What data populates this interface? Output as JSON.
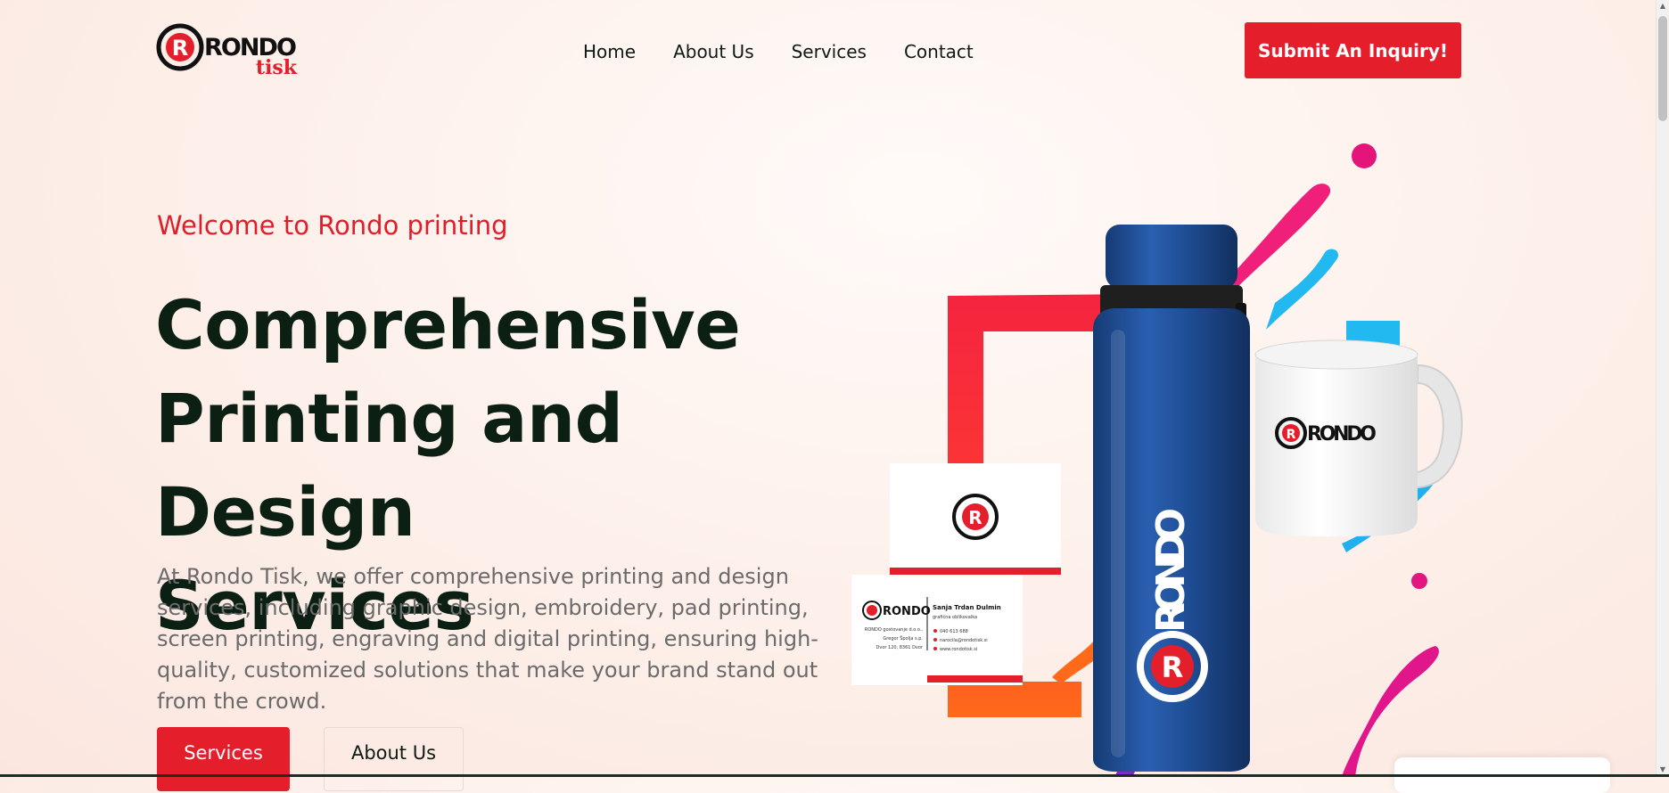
{
  "brand": {
    "logo_main": "RONDO",
    "logo_sub": "tisk",
    "logo_letter": "R"
  },
  "nav": {
    "items": [
      "Home",
      "About Us",
      "Services",
      "Contact"
    ]
  },
  "header": {
    "cta_label": "Submit An Inquiry!"
  },
  "hero": {
    "welcome": "Welcome to Rondo printing",
    "headline_line1": "Comprehensive",
    "headline_line2": "Printing and Design",
    "headline_line3": "Services",
    "description": "At Rondo Tisk, we offer comprehensive printing and design services, including graphic design, embroidery, pad printing, screen printing, engraving and digital printing, ensuring high-quality, customized solutions that make your brand stand out from the crowd.",
    "primary_button": "Services",
    "secondary_button": "About Us"
  },
  "products": {
    "bottle_text": "RONDO",
    "mug_text": "RONDO",
    "card_brand": "RONDO",
    "card_name": "Sanja Trdan Dulmin",
    "card_role": "grafična oblikovalka",
    "card_company_line1": "RONDO gostovanje d.o.o.,",
    "card_company_line2": "Gregor Špolja s.p.",
    "card_company_line3": "Dvor 120, 8361 Dvor",
    "card_phone": "040 613 688",
    "card_email": "narocila@rondotisk.si",
    "card_web": "www.rondotisk.si"
  },
  "colors": {
    "accent": "#e41e2b",
    "heading": "#0b2013",
    "bottle": "#1f4e96",
    "star": "#f8a24a"
  }
}
